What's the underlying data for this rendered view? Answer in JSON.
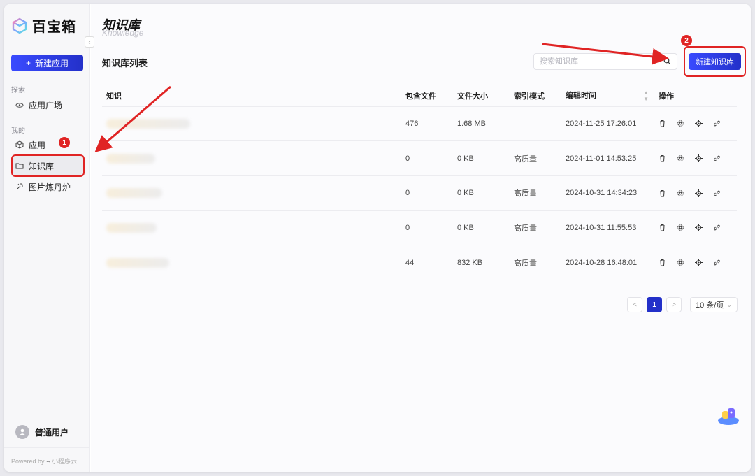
{
  "app": {
    "name": "百宝箱"
  },
  "sidebar": {
    "new_app_label": "新建应用",
    "section_explore": "探索",
    "explore_items": [
      {
        "label": "应用广场",
        "icon": "sparkle-eye-icon"
      }
    ],
    "section_mine": "我的",
    "mine_items": [
      {
        "label": "应用",
        "icon": "cube-icon"
      },
      {
        "label": "知识库",
        "icon": "folder-icon",
        "active": true
      },
      {
        "label": "图片炼丹炉",
        "icon": "magic-icon"
      }
    ],
    "user_name": "普通用户",
    "powered_by": "Powered by",
    "powered_brand": "小程序云"
  },
  "page": {
    "title": "知识库",
    "subtitle": "Knowledge",
    "list_title": "知识库列表",
    "search_placeholder": "搜索知识库",
    "create_label": "新建知识库"
  },
  "table": {
    "columns": [
      "知识",
      "包含文件",
      "文件大小",
      "索引模式",
      "编辑时间",
      "操作"
    ],
    "rows": [
      {
        "files": "476",
        "size": "1.68 MB",
        "mode": "",
        "time": "2024-11-25 17:26:01"
      },
      {
        "files": "0",
        "size": "0 KB",
        "mode": "高质量",
        "time": "2024-11-01 14:53:25"
      },
      {
        "files": "0",
        "size": "0 KB",
        "mode": "高质量",
        "time": "2024-10-31 14:34:23"
      },
      {
        "files": "0",
        "size": "0 KB",
        "mode": "高质量",
        "time": "2024-10-31 11:55:53"
      },
      {
        "files": "44",
        "size": "832 KB",
        "mode": "高质量",
        "time": "2024-10-28 16:48:01"
      }
    ],
    "row_actions": [
      "trash-icon",
      "settings-icon",
      "target-icon",
      "link-icon"
    ]
  },
  "pagination": {
    "current": "1",
    "page_size": "10 条/页",
    "prev": "<",
    "next": ">"
  },
  "annotations": {
    "badge_1": "1",
    "badge_2": "2"
  },
  "colors": {
    "accent": "#2330c9",
    "annotation": "#e02424"
  }
}
